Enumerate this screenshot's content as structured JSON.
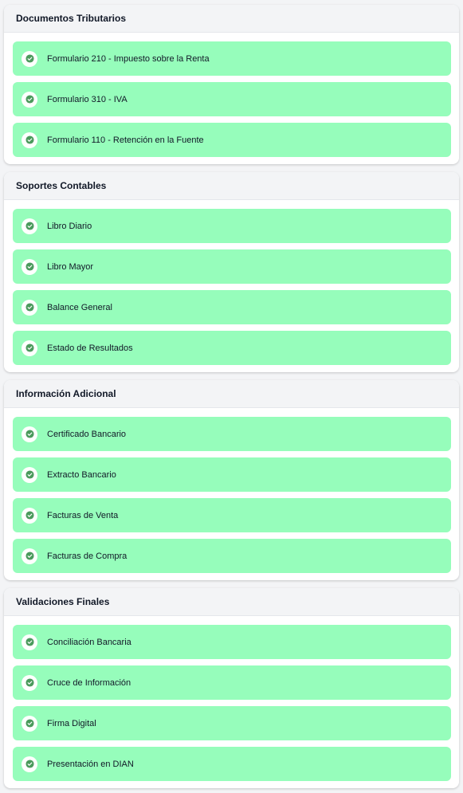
{
  "sections": [
    {
      "title": "Documentos Tributarios",
      "items": [
        {
          "label": "Formulario 210 - Impuesto sobre la Renta",
          "status": "checked"
        },
        {
          "label": "Formulario 310 - IVA",
          "status": "checked"
        },
        {
          "label": "Formulario 110 - Retención en la Fuente",
          "status": "checked"
        }
      ]
    },
    {
      "title": "Soportes Contables",
      "items": [
        {
          "label": "Libro Diario",
          "status": "checked"
        },
        {
          "label": "Libro Mayor",
          "status": "checked"
        },
        {
          "label": "Balance General",
          "status": "checked"
        },
        {
          "label": "Estado de Resultados",
          "status": "checked"
        }
      ]
    },
    {
      "title": "Información Adicional",
      "items": [
        {
          "label": "Certificado Bancario",
          "status": "checked"
        },
        {
          "label": "Extracto Bancario",
          "status": "checked"
        },
        {
          "label": "Facturas de Venta",
          "status": "checked"
        },
        {
          "label": "Facturas de Compra",
          "status": "checked"
        }
      ]
    },
    {
      "title": "Validaciones Finales",
      "items": [
        {
          "label": "Conciliación Bancaria",
          "status": "checked"
        },
        {
          "label": "Cruce de Información",
          "status": "checked"
        },
        {
          "label": "Firma Digital",
          "status": "checked"
        },
        {
          "label": "Presentación en DIAN",
          "status": "checked"
        }
      ]
    }
  ],
  "colors": {
    "item_background": "#96fdbb",
    "check_icon": "#4a9a5c",
    "header_background": "#f3f4f6"
  },
  "icons": {
    "item_status": "check-circle-icon"
  }
}
